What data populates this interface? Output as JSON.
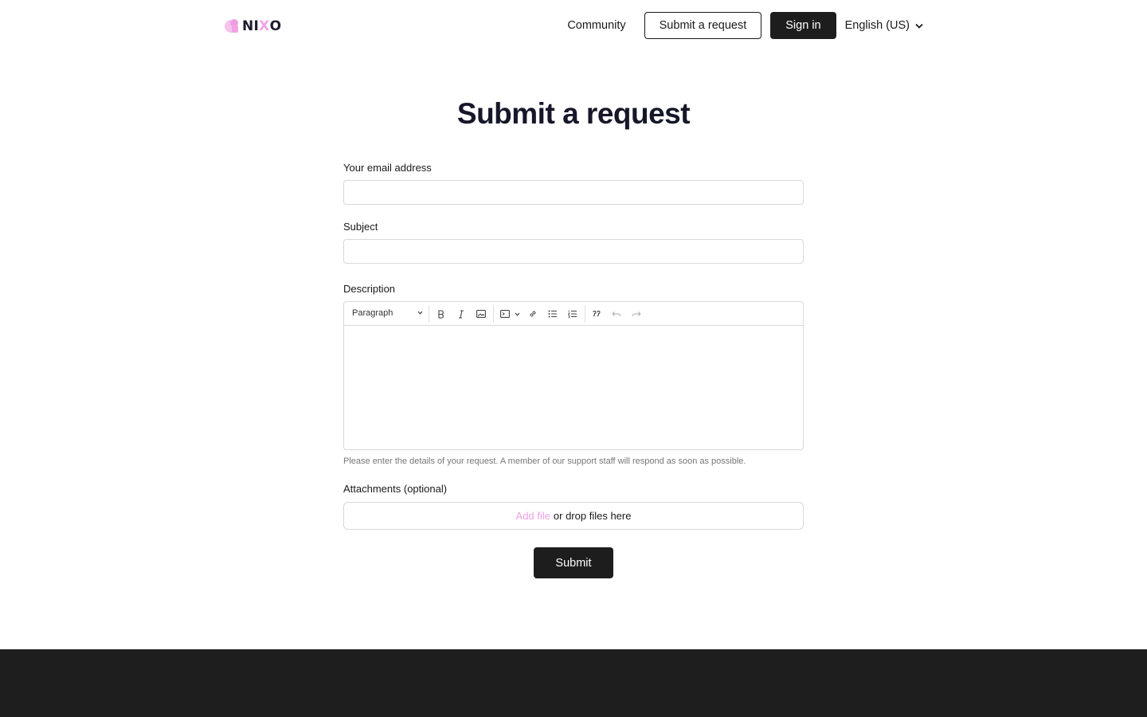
{
  "header": {
    "logo_text_1": "NI",
    "logo_text_x": "X",
    "logo_text_2": "O",
    "nav_community": "Community",
    "nav_submit": "Submit a request",
    "nav_signin": "Sign in",
    "language": "English (US)"
  },
  "main": {
    "title": "Submit a request",
    "email_label": "Your email address",
    "email_value": "",
    "subject_label": "Subject",
    "subject_value": "",
    "description_label": "Description",
    "editor": {
      "block_format": "Paragraph",
      "tools": [
        "bold-icon",
        "italic-icon",
        "image-icon",
        "code-block-icon",
        "link-icon",
        "bullet-list-icon",
        "numbered-list-icon",
        "quote-icon",
        "undo-icon",
        "redo-icon"
      ]
    },
    "description_hint": "Please enter the details of your request. A member of our support staff will respond as soon as possible.",
    "attachments_label": "Attachments (optional)",
    "add_file": "Add file",
    "drop_text": "or drop files here",
    "submit_label": "Submit"
  },
  "colors": {
    "brand_pink": "#ee9fe2",
    "dark": "#1d1d1d",
    "footer": "#1e1e1e"
  }
}
